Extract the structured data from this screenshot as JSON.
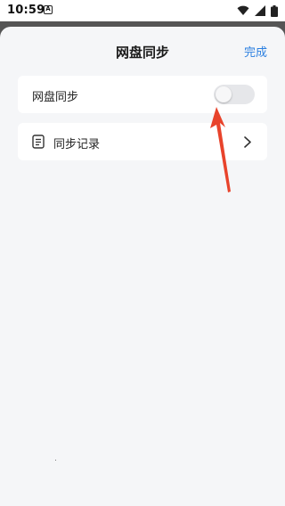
{
  "status_bar": {
    "time": "10:59",
    "left_icon": "a-letter-icon",
    "right_icons": [
      "wifi-icon",
      "signal-icon",
      "battery-icon"
    ]
  },
  "nav": {
    "title": "网盘同步",
    "done_label": "完成"
  },
  "sync_card": {
    "label": "网盘同步",
    "toggle_on": false
  },
  "record_card": {
    "icon": "document-icon",
    "label": "同步记录",
    "chevron": "chevron-right-icon"
  },
  "colors": {
    "accent": "#2b7fe0",
    "annotation_arrow": "#e8432b",
    "page_background": "#f5f6f8"
  }
}
